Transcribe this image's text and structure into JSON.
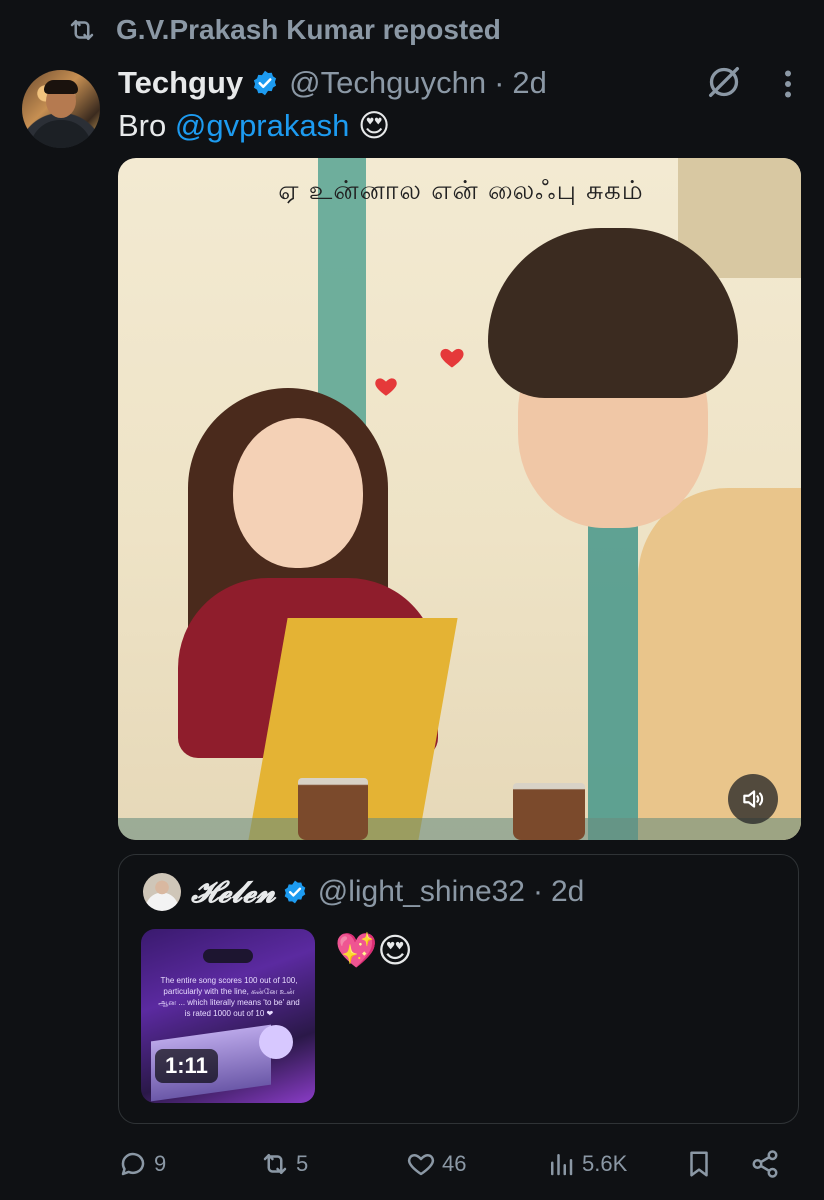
{
  "repost": {
    "text": "G.V.Prakash Kumar reposted",
    "icon": "repost-icon"
  },
  "post": {
    "author_name": "Techguy",
    "handle": "@Techguychn",
    "separator": "·",
    "time": "2d",
    "text_prefix": "Bro ",
    "mention": "@gvprakash",
    "text_suffix": " 😍",
    "media": {
      "caption": "ஏ உன்னால என் லைஃபு சுகம்",
      "volume_icon": "volume-icon"
    }
  },
  "quote": {
    "author_name": "𝓗𝓮𝓵𝓮𝓷",
    "handle": "@light_shine32",
    "separator": "·",
    "time": "2d",
    "text": "💖😍",
    "video_duration": "1:11",
    "thumb_text": "The entire song scores 100 out of 100, particularly with the line, கன்னே உன் ஆன ...  which literally means 'to be' and is rated 1000 out of 10 ❤"
  },
  "actions": {
    "replies": "9",
    "reposts": "5",
    "likes": "46",
    "views": "5.6K"
  },
  "colors": {
    "background": "#0f1114",
    "text": "#e7e9ea",
    "muted": "#8b98a5",
    "accent": "#1d9bf0",
    "border": "#2f3336"
  }
}
